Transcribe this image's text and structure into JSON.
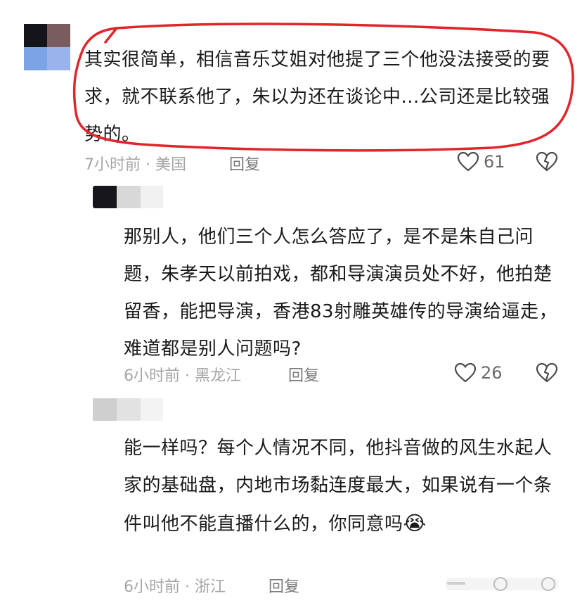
{
  "comments": [
    {
      "text": "其实很简单，相信音乐艾姐对他提了三个他没法接受的要求，就不联系他了，朱以为还在谈论中...公司还是比较强势的。",
      "time": "7小时前",
      "location": "美国",
      "meta_sep": " · ",
      "reply_label": "回复",
      "likes": "61"
    },
    {
      "text": "那别人，他们三个人怎么答应了，是不是朱自己问题，朱孝天以前拍戏，都和导演演员处不好，他拍楚留香，能把导演，香港83射雕英雄传的导演给逼走，难道都是别人问题吗?",
      "time": "6小时前",
      "location": "黑龙江",
      "meta_sep": " · ",
      "reply_label": "回复",
      "likes": "26"
    },
    {
      "text": "能一样吗？每个人情况不同，他抖音做的风生水起人家的基础盘，内地市场黏连度最大，如果说有一个条件叫他不能直播什么的，你同意吗",
      "emoji": "😭",
      "time": "6小时前",
      "location": "浙江",
      "meta_sep": " · ",
      "reply_label": "回复"
    }
  ],
  "colors": {
    "annotation_ring": "#e0262b",
    "meta_text": "#a5a5a5",
    "body_text": "#1a1a1a"
  },
  "icons": [
    "heart-icon",
    "dislike-heart-icon"
  ]
}
